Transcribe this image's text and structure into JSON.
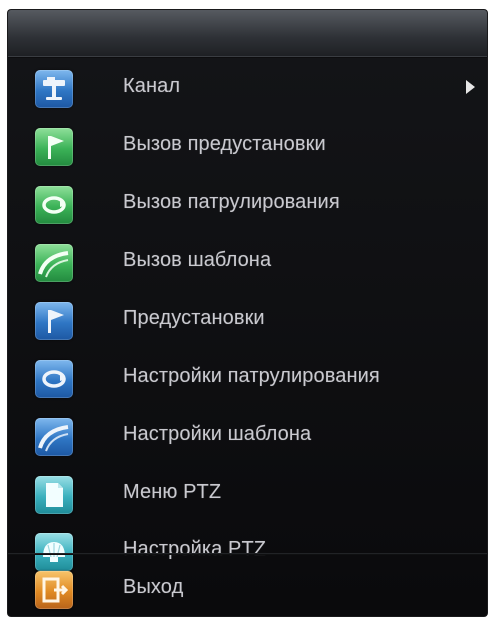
{
  "menu": {
    "items": [
      {
        "label": "Канал",
        "icon": "channel-camera-icon",
        "has_submenu": true
      },
      {
        "label": "Вызов предустановки",
        "icon": "flag-icon"
      },
      {
        "label": "Вызов патрулирования",
        "icon": "cycle-icon"
      },
      {
        "label": "Вызов шаблона",
        "icon": "curve-icon"
      },
      {
        "label": "Предустановки",
        "icon": "flag-icon"
      },
      {
        "label": "Настройки патрулирования",
        "icon": "cycle-icon"
      },
      {
        "label": "Настройки шаблона",
        "icon": "curve-icon"
      },
      {
        "label": "Меню PTZ",
        "icon": "document-icon"
      },
      {
        "label": "Настройка PTZ",
        "icon": "shell-icon"
      }
    ],
    "exit": {
      "label": "Выход",
      "icon": "exit-door-icon"
    }
  },
  "colors": {
    "blue": "#2f76c4",
    "green": "#3bb257",
    "teal": "#3ab0bd",
    "orange": "#e08a23",
    "text": "#c9c9cf"
  }
}
